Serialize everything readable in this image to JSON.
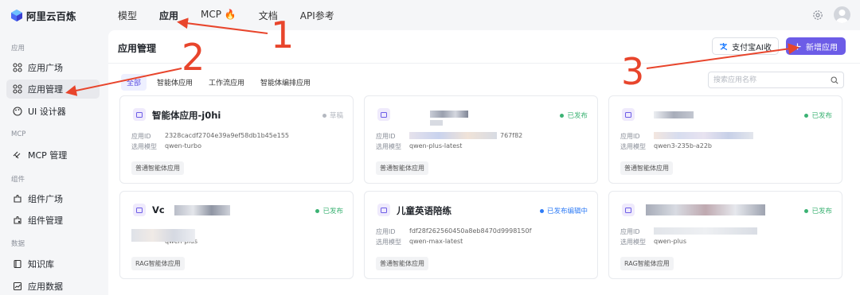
{
  "brand": {
    "name": "阿里云百炼"
  },
  "nav": {
    "items": [
      "模型",
      "应用",
      "MCP 🔥",
      "文档",
      "API参考"
    ]
  },
  "sidebar": {
    "sections": {
      "apps": "应用",
      "mcp": "MCP",
      "components": "组件",
      "data": "数据"
    },
    "items": [
      "应用广场",
      "应用管理",
      "UI 设计器",
      "MCP 管理",
      "组件广场",
      "组件管理",
      "知识库",
      "应用数据"
    ]
  },
  "main": {
    "title": "应用管理",
    "alipay_button": "支付宝AI收",
    "new_button": "新增应用",
    "tabs": [
      "全部",
      "智能体应用",
      "工作流应用",
      "智能体编排应用"
    ],
    "search_placeholder": "搜索应用名称"
  },
  "labels": {
    "app_id": "应用ID",
    "model": "选用模型"
  },
  "cards": [
    {
      "title": "智能体应用-j0hi",
      "status": "草稿",
      "status_color": "#b4b8c0",
      "app_id": "2328cacdf2704e39a9ef58db1b45e155",
      "model": "qwen-turbo",
      "tag": "普通智能体应用"
    },
    {
      "title": "",
      "status": "已发布",
      "status_color": "#3bb273",
      "app_id": "767f82",
      "model": "qwen-plus-latest",
      "tag": "普通智能体应用"
    },
    {
      "title": "",
      "status": "已发布",
      "status_color": "#3bb273",
      "app_id": "",
      "model": "qwen3-235b-a22b",
      "tag": "普通智能体应用"
    },
    {
      "title": "Vc",
      "status": "已发布",
      "status_color": "#3bb273",
      "app_id": "",
      "model": "qwen-plus",
      "tag": "RAG智能体应用"
    },
    {
      "title": "儿童英语陪练",
      "status": "已发布编辑中",
      "status_color": "#2f7cf6",
      "app_id": "fdf28f262560450a8eb8470d9998150f",
      "model": "qwen-max-latest",
      "tag": "普通智能体应用"
    },
    {
      "title": "",
      "status": "已发布",
      "status_color": "#3bb273",
      "app_id": "",
      "model": "qwen-plus",
      "tag": "RAG智能体应用"
    }
  ],
  "annotations": {
    "n1": "1",
    "n2": "2",
    "n3": "3",
    "color": "#e8452c"
  },
  "colors": {
    "accent": "#6c5ce7",
    "published": "#3bb273",
    "editing": "#2f7cf6"
  }
}
